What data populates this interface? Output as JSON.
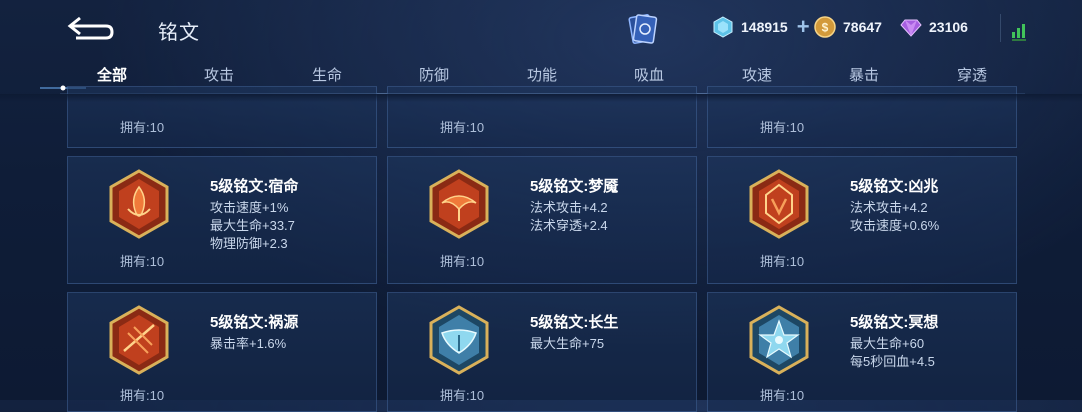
{
  "header": {
    "title": "铭文",
    "currencies": [
      {
        "name": "diamond-icon",
        "value": "148915"
      },
      {
        "name": "coin-icon",
        "value": "78647"
      },
      {
        "name": "gem-icon",
        "value": "23106"
      }
    ],
    "plus_label": "+"
  },
  "tabs": [
    "全部",
    "攻击",
    "生命",
    "防御",
    "功能",
    "吸血",
    "攻速",
    "暴击",
    "穿透"
  ],
  "active_tab": "全部",
  "top_row_owned": [
    "拥有:10",
    "拥有:10",
    "拥有:10"
  ],
  "runes": [
    {
      "name": "5级铭文:宿命",
      "attrs": [
        "攻击速度+1%",
        "最大生命+33.7",
        "物理防御+2.3"
      ],
      "owned": "拥有:10",
      "color": "red"
    },
    {
      "name": "5级铭文:梦魇",
      "attrs": [
        "法术攻击+4.2",
        "法术穿透+2.4"
      ],
      "owned": "拥有:10",
      "color": "red"
    },
    {
      "name": "5级铭文:凶兆",
      "attrs": [
        "法术攻击+4.2",
        "攻击速度+0.6%"
      ],
      "owned": "拥有:10",
      "color": "red"
    },
    {
      "name": "5级铭文:祸源",
      "attrs": [
        "暴击率+1.6%"
      ],
      "owned": "拥有:10",
      "color": "red"
    },
    {
      "name": "5级铭文:长生",
      "attrs": [
        "最大生命+75"
      ],
      "owned": "拥有:10",
      "color": "blue"
    },
    {
      "name": "5级铭文:冥想",
      "attrs": [
        "最大生命+60",
        "每5秒回血+4.5"
      ],
      "owned": "拥有:10",
      "color": "blue"
    }
  ],
  "colors": {
    "red": "#c0401e",
    "blue": "#3f7fa8",
    "gold": "#d9b15a"
  }
}
